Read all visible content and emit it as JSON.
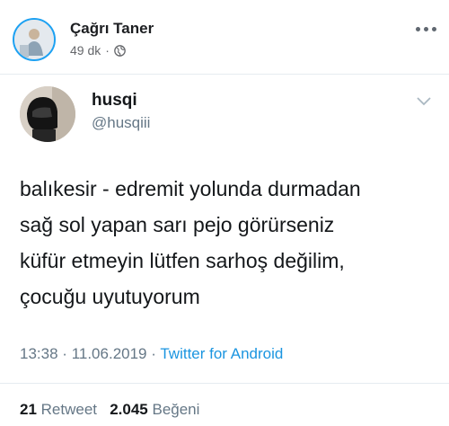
{
  "post": {
    "author": "Çağrı Taner",
    "time": "49 dk",
    "separator": "·",
    "privacy_icon": "globe-icon",
    "more_icon": "more-horizontal-icon"
  },
  "tweet": {
    "name": "husqi",
    "handle": "@husqiii",
    "lines": [
      "balıkesir - edremit yolunda durmadan",
      "sağ sol yapan sarı pejo görürseniz",
      "küfür etmeyin lütfen sarhoş değilim,",
      "çocuğu uyutuyorum"
    ],
    "time": "13:38",
    "date": "11.06.2019",
    "separator": "·",
    "source": "Twitter for Android",
    "retweet_count": "21",
    "retweet_label": "Retweet",
    "like_count": "2.045",
    "like_label": "Beğeni",
    "chevron_icon": "chevron-down-icon"
  },
  "colors": {
    "link": "#1b95e0",
    "muted": "#657786",
    "text": "#14171a"
  }
}
